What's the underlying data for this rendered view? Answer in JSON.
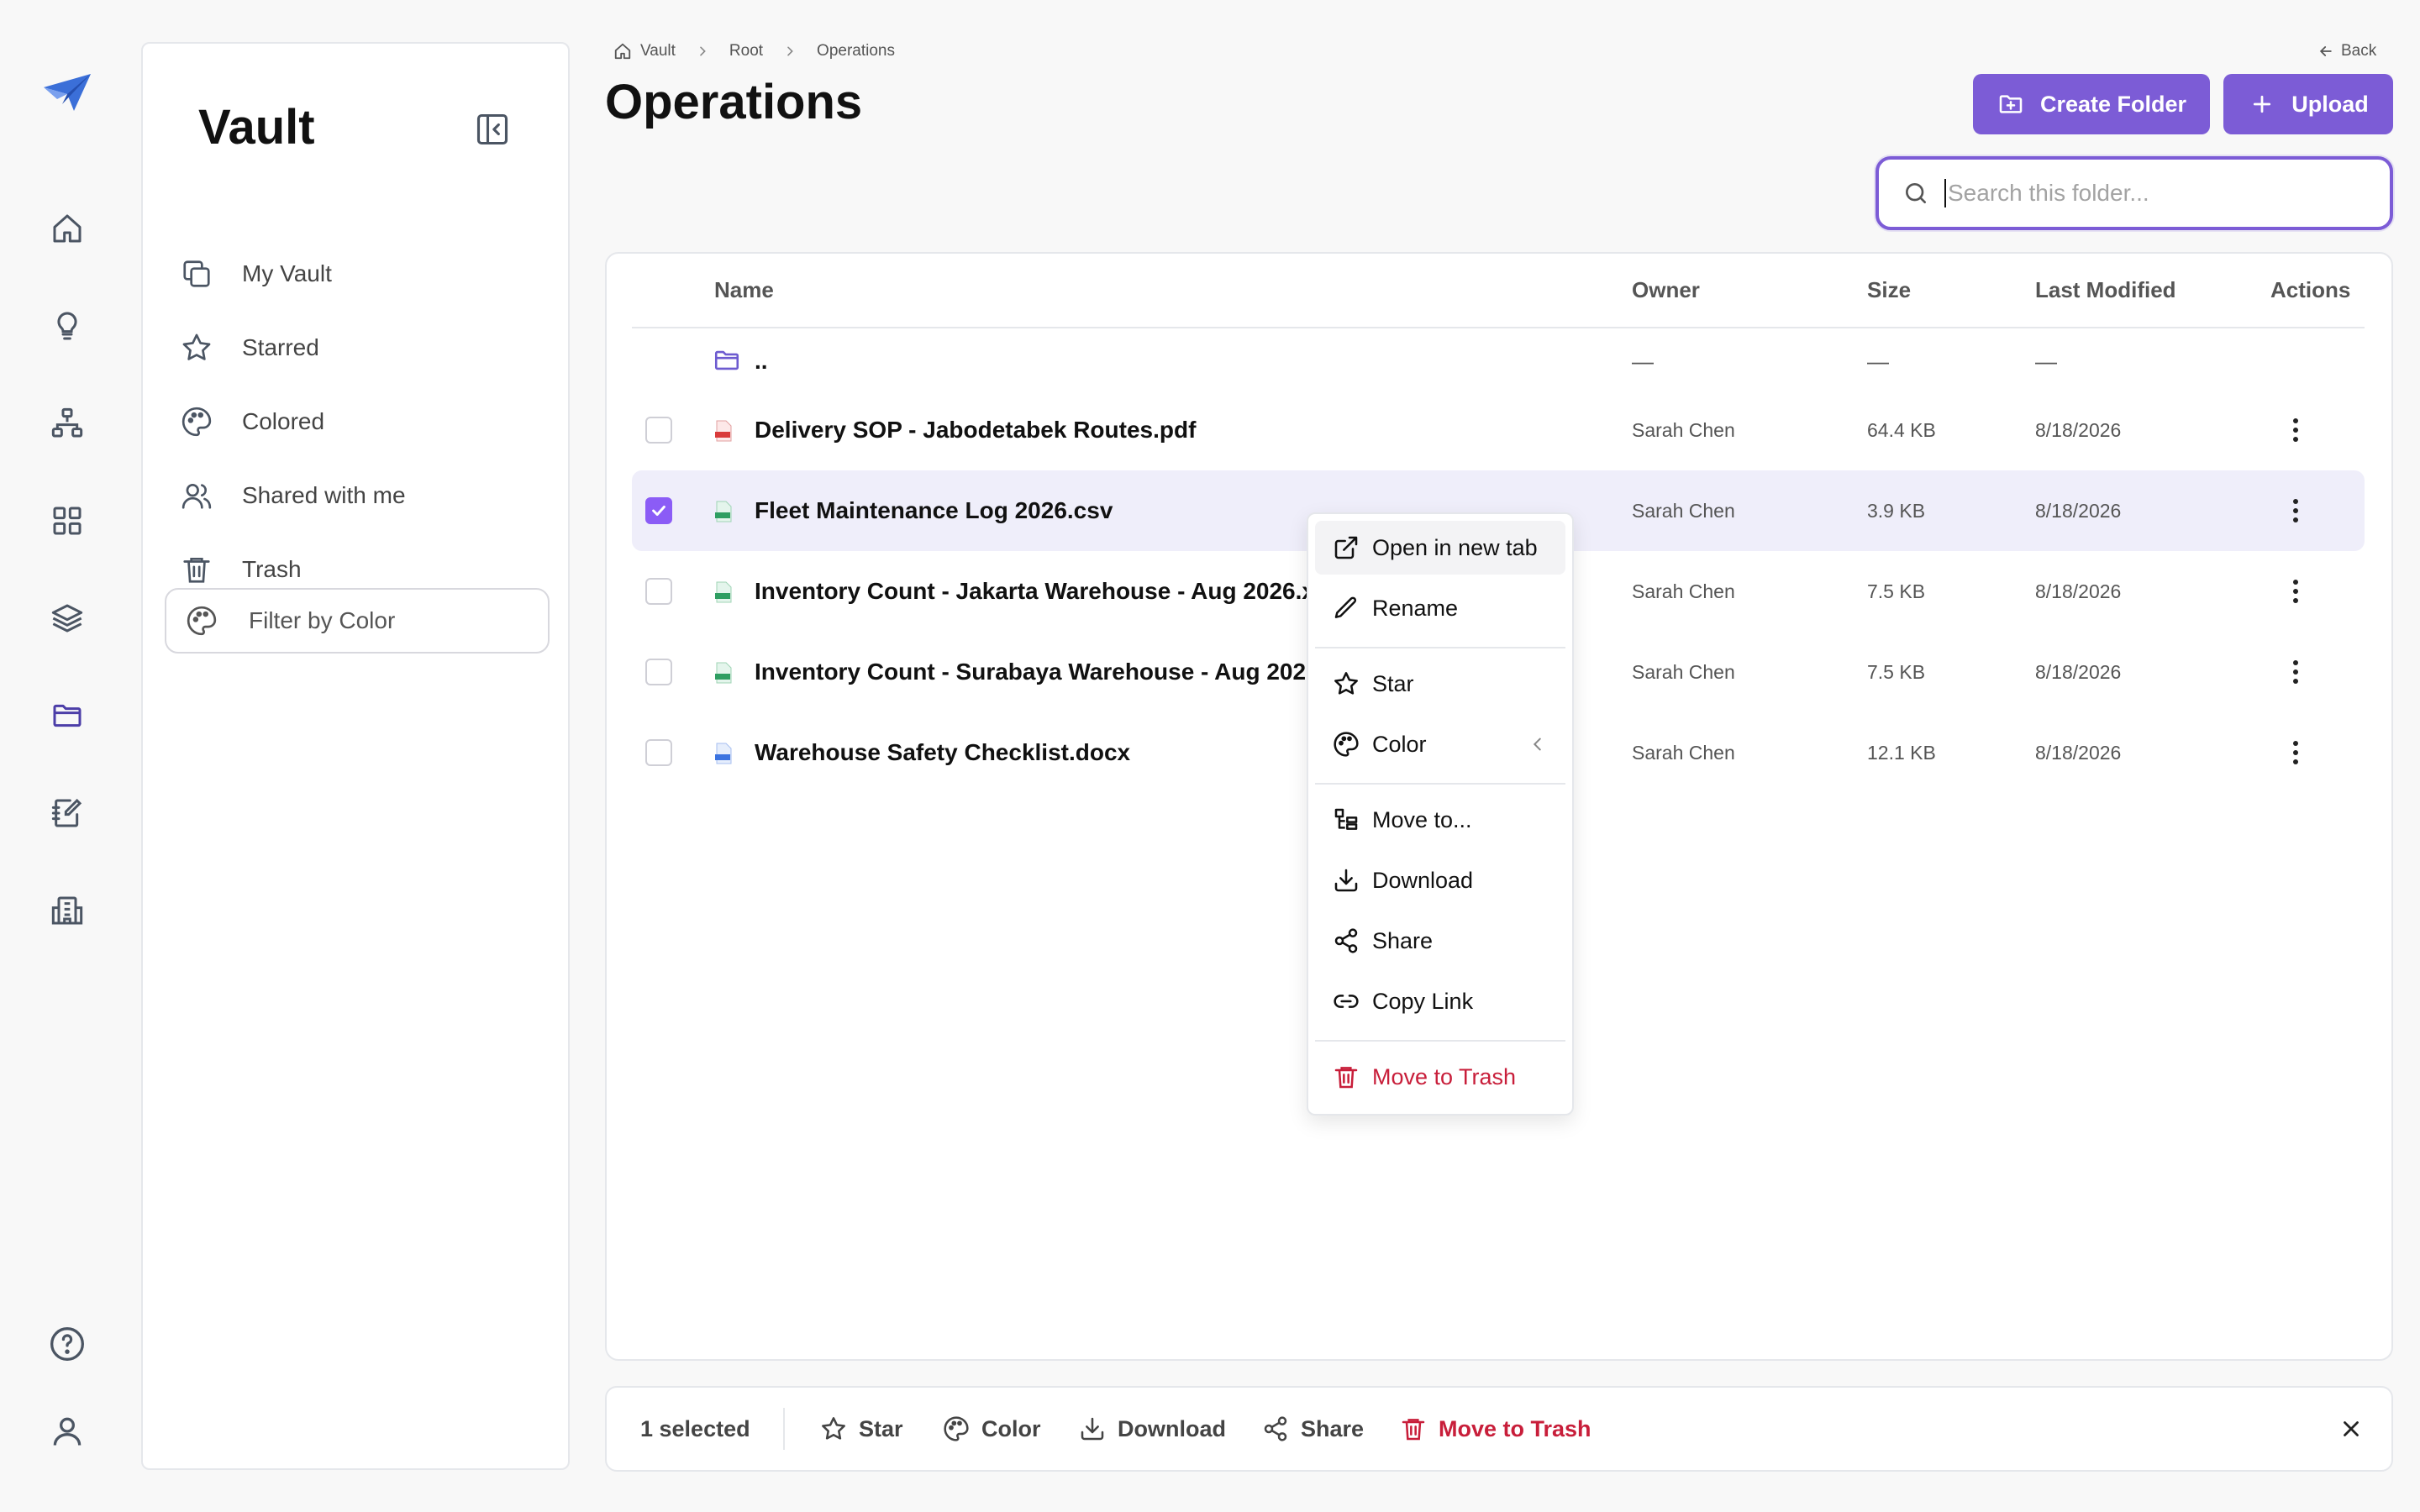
{
  "rail": {
    "items": [
      {
        "name": "home-icon"
      },
      {
        "name": "lightbulb-icon"
      },
      {
        "name": "org-chart-icon"
      },
      {
        "name": "grid-icon"
      },
      {
        "name": "layers-icon"
      },
      {
        "name": "folder-icon"
      },
      {
        "name": "notebook-edit-icon"
      },
      {
        "name": "building-icon"
      }
    ],
    "bottom": [
      {
        "name": "help-icon"
      },
      {
        "name": "user-icon"
      }
    ]
  },
  "sidebar": {
    "title": "Vault",
    "items": [
      {
        "label": "My Vault",
        "icon": "copy-icon"
      },
      {
        "label": "Starred",
        "icon": "star-icon"
      },
      {
        "label": "Colored",
        "icon": "palette-icon"
      },
      {
        "label": "Shared with me",
        "icon": "users-icon"
      },
      {
        "label": "Trash",
        "icon": "trash-icon"
      }
    ],
    "filter_label": "Filter by Color"
  },
  "breadcrumb": {
    "items": [
      "Vault",
      "Root",
      "Operations"
    ]
  },
  "header": {
    "back_label": "Back",
    "title": "Operations",
    "create_folder_label": "Create Folder",
    "upload_label": "Upload",
    "accent_color": "#7c5cd6"
  },
  "search": {
    "placeholder": "Search this folder...",
    "value": ""
  },
  "table": {
    "columns": [
      "Name",
      "Owner",
      "Size",
      "Last Modified",
      "Actions"
    ],
    "parent_row": {
      "name": "..",
      "owner": "—",
      "size": "—",
      "modified": "—"
    },
    "rows": [
      {
        "name": "Delivery SOP - Jabodetabek Routes.pdf",
        "type": "pdf",
        "owner": "Sarah Chen",
        "size": "64.4 KB",
        "modified": "8/18/2026",
        "selected": false
      },
      {
        "name": "Fleet Maintenance Log 2026.csv",
        "type": "csv",
        "owner": "Sarah Chen",
        "size": "3.9 KB",
        "modified": "8/18/2026",
        "selected": true
      },
      {
        "name": "Inventory Count - Jakarta Warehouse - Aug 2026.xlsx",
        "type": "xlsx",
        "owner": "Sarah Chen",
        "size": "7.5 KB",
        "modified": "8/18/2026",
        "selected": false
      },
      {
        "name": "Inventory Count - Surabaya Warehouse - Aug 2026.xlsx",
        "type": "xlsx",
        "owner": "Sarah Chen",
        "size": "7.5 KB",
        "modified": "8/18/2026",
        "selected": false
      },
      {
        "name": "Warehouse Safety Checklist.docx",
        "type": "docx",
        "owner": "Sarah Chen",
        "size": "12.1 KB",
        "modified": "8/18/2026",
        "selected": false
      }
    ]
  },
  "context_menu": {
    "items": [
      {
        "label": "Open in new tab",
        "icon": "external-link-icon"
      },
      {
        "label": "Rename",
        "icon": "pencil-icon"
      },
      {
        "label": "Star",
        "icon": "star-icon"
      },
      {
        "label": "Color",
        "icon": "palette-icon"
      },
      {
        "label": "Move to...",
        "icon": "move-icon"
      },
      {
        "label": "Download",
        "icon": "download-icon"
      },
      {
        "label": "Share",
        "icon": "share-icon"
      },
      {
        "label": "Copy Link",
        "icon": "link-icon"
      },
      {
        "label": "Move to Trash",
        "icon": "trash-icon"
      }
    ]
  },
  "bulk_bar": {
    "selected_label": "1 selected",
    "star_label": "Star",
    "color_label": "Color",
    "download_label": "Download",
    "share_label": "Share",
    "trash_label": "Move to Trash",
    "danger_color": "#c81e3a"
  }
}
